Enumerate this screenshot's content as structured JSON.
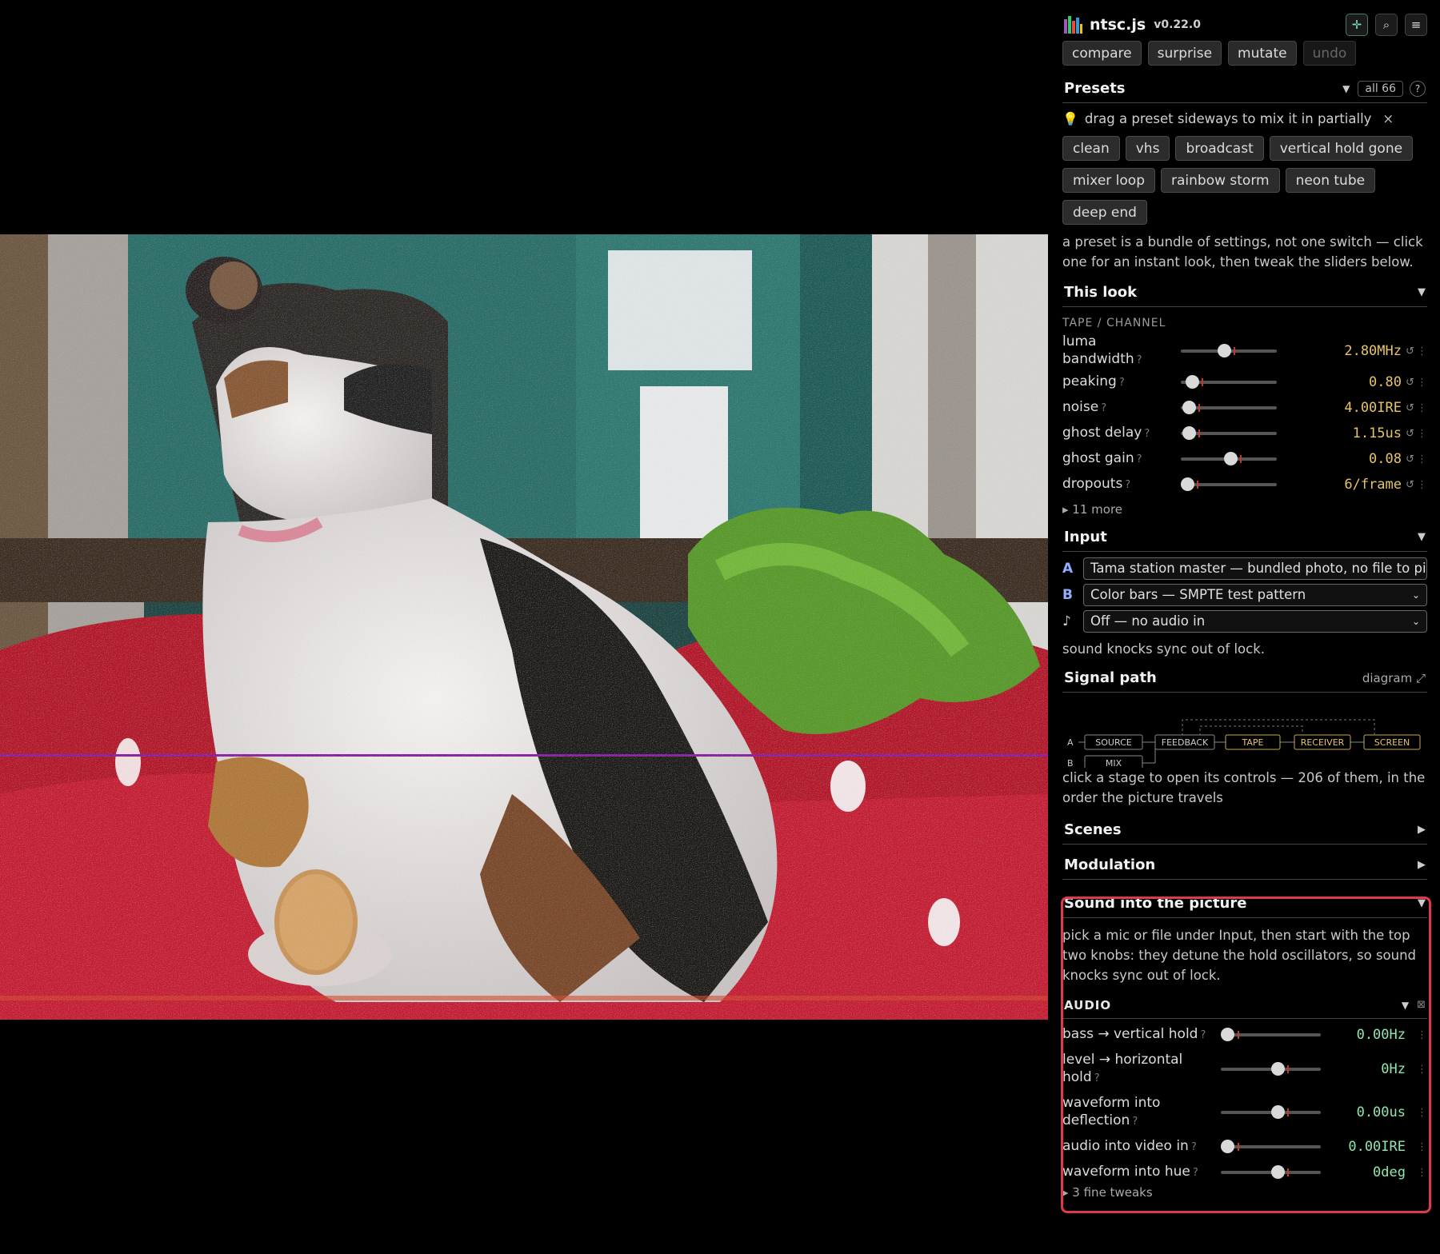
{
  "app": {
    "name": "ntsc.js",
    "version": "v0.22.0"
  },
  "toolbar": {
    "compare": "compare",
    "surprise": "surprise",
    "mutate": "mutate",
    "undo": "undo"
  },
  "icons": {
    "crosshair": "crosshair-icon",
    "search": "search-icon",
    "menu": "menu-icon"
  },
  "presets": {
    "title": "Presets",
    "filter": "all 66",
    "help": "?",
    "hint": "drag a preset sideways to mix it in partially",
    "hint_close": "×",
    "items": [
      "clean",
      "vhs",
      "broadcast",
      "vertical hold gone",
      "mixer loop",
      "rainbow storm",
      "neon tube",
      "deep end"
    ],
    "description": "a preset is a bundle of settings, not one switch — click one for an instant look, then tweak the sliders below."
  },
  "look": {
    "title": "This look",
    "group": "TAPE / CHANNEL",
    "sliders": [
      {
        "label": "luma bandwidth",
        "value": "2.80MHz",
        "level": 0.45
      },
      {
        "label": "peaking",
        "value": "0.80",
        "level": 0.12
      },
      {
        "label": "noise",
        "value": "4.00IRE",
        "level": 0.08
      },
      {
        "label": "ghost delay",
        "value": "1.15us",
        "level": 0.08
      },
      {
        "label": "ghost gain",
        "value": "0.08",
        "level": 0.52
      },
      {
        "label": "dropouts",
        "value": "6/frame",
        "level": 0.07
      }
    ],
    "more": "▸ 11 more"
  },
  "input": {
    "title": "Input",
    "a_label": "A",
    "a_value": "Tama station master — bundled photo, no file to pick",
    "b_label": "B",
    "b_value": "Color bars — SMPTE test pattern",
    "audio_label": "♪",
    "audio_value": "Off — no audio in",
    "note": "sound knocks sync out of lock."
  },
  "signal": {
    "title": "Signal path",
    "diagram_link": "diagram ⤢",
    "nodes": {
      "a": "A",
      "b": "B",
      "source": "SOURCE",
      "mix": "MIX",
      "feedback": "FEEDBACK",
      "tape": "TAPE",
      "receiver": "RECEIVER",
      "screen": "SCREEN"
    },
    "description": "click a stage to open its controls — 206 of them, in the order the picture travels"
  },
  "scenes": {
    "title": "Scenes"
  },
  "modulation": {
    "title": "Modulation"
  },
  "sound": {
    "title": "Sound into the picture",
    "description": "pick a mic or file under Input, then start with the top two knobs: they detune the hold oscillators, so sound knocks sync out of lock.",
    "group": "AUDIO",
    "sliders": [
      {
        "label": "bass → vertical hold",
        "value": "0.00Hz",
        "level": 0.0
      },
      {
        "label": "level → horizontal hold",
        "value": "0Hz",
        "level": 0.5
      },
      {
        "label": "waveform into deflection",
        "value": "0.00us",
        "level": 0.5
      },
      {
        "label": "audio into video in",
        "value": "0.00IRE",
        "level": 0.0
      },
      {
        "label": "waveform into hue",
        "value": "0deg",
        "level": 0.5
      }
    ],
    "fine": "▸ 3 fine tweaks"
  },
  "colors": {
    "accent_yellow": "#e6c46a",
    "accent_green": "#8fe6b0",
    "focus_red": "#e0394a"
  }
}
